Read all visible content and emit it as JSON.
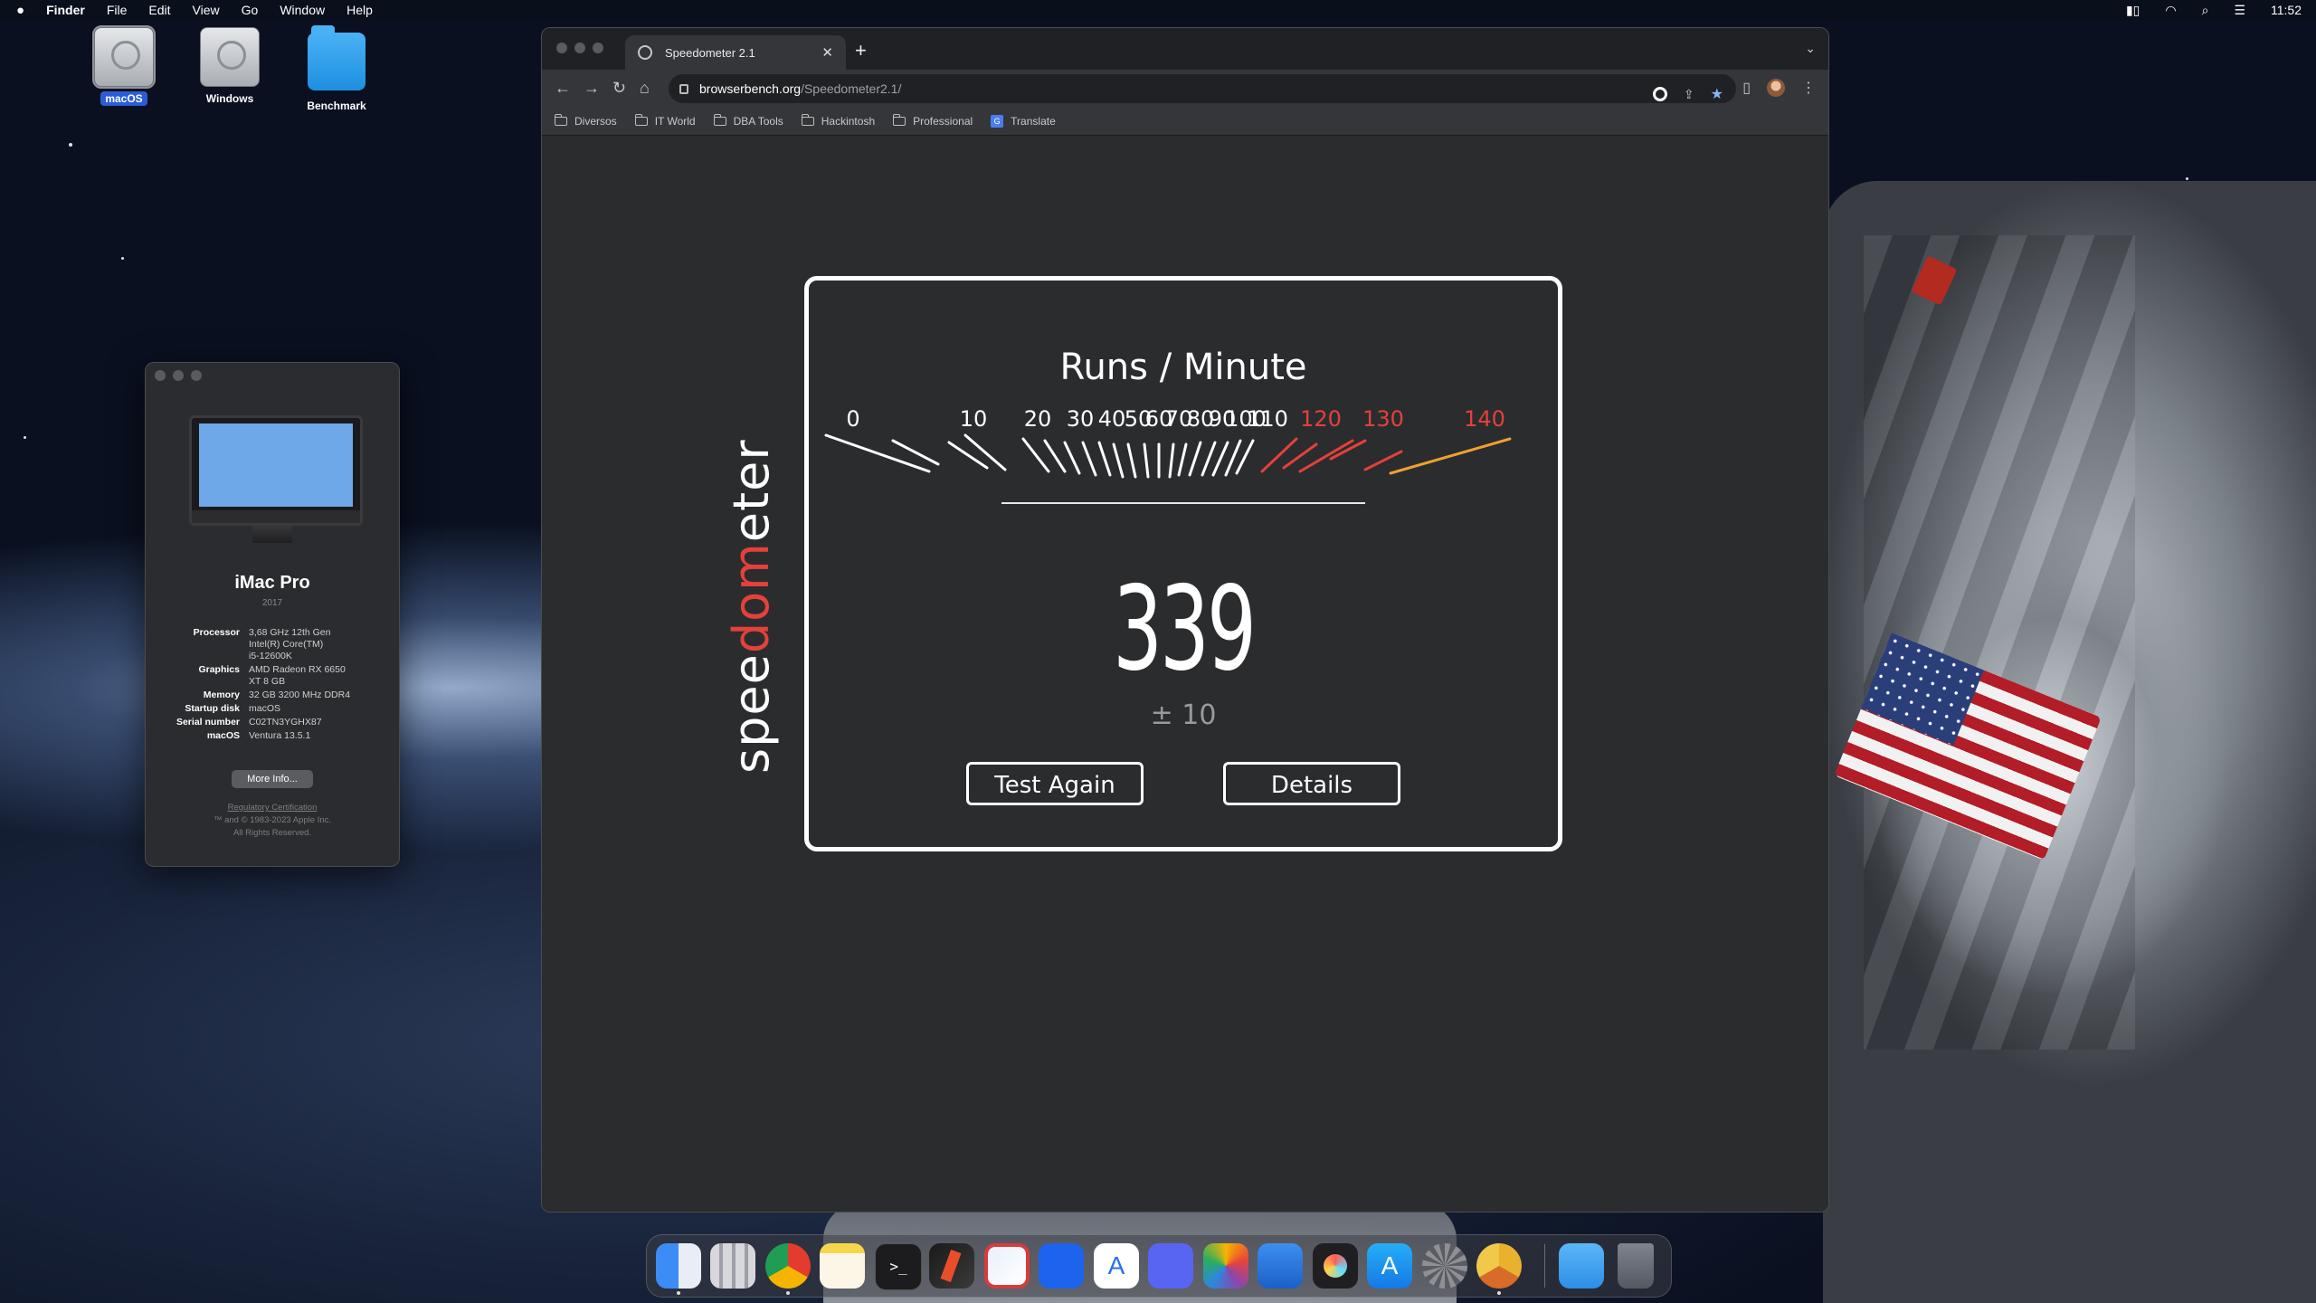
{
  "menubar": {
    "app": "Finder",
    "items": [
      "File",
      "Edit",
      "View",
      "Go",
      "Window",
      "Help"
    ],
    "clock": "11:52"
  },
  "desktop": {
    "icons": [
      {
        "label": "macOS",
        "kind": "disk-icon",
        "selected": true
      },
      {
        "label": "Windows",
        "kind": "disk-icon",
        "selected": false
      },
      {
        "label": "Benchmark",
        "kind": "folder-icon",
        "selected": false
      }
    ]
  },
  "about": {
    "model": "iMac Pro",
    "year": "2017",
    "specs": [
      {
        "key": "Processor",
        "value": "3,68 GHz 12th Gen\nIntel(R) Core(TM)\ni5-12600K"
      },
      {
        "key": "Graphics",
        "value": "AMD Radeon RX 6650\nXT 8 GB"
      },
      {
        "key": "Memory",
        "value": "32 GB 3200 MHz DDR4"
      },
      {
        "key": "Startup disk",
        "value": "macOS"
      },
      {
        "key": "Serial number",
        "value": "C02TN3YGHX87"
      },
      {
        "key": "macOS",
        "value": "Ventura 13.5.1"
      }
    ],
    "more_button": "More Info...",
    "regulatory": "Regulatory Certification",
    "copyright": "™ and © 1983-2023 Apple Inc.",
    "rights": "All Rights Reserved."
  },
  "browser": {
    "tab_title": "Speedometer 2.1",
    "url_host": "browserbench.org",
    "url_path": "/Speedometer2.1/",
    "bookmarks": [
      {
        "label": "Diversos",
        "icon": "folder-icon"
      },
      {
        "label": "IT World",
        "icon": "folder-icon"
      },
      {
        "label": "DBA Tools",
        "icon": "folder-icon"
      },
      {
        "label": "Hackintosh",
        "icon": "folder-icon"
      },
      {
        "label": "Professional",
        "icon": "folder-icon"
      },
      {
        "label": "Translate",
        "icon": "translate-icon"
      }
    ]
  },
  "speedometer": {
    "brand_pre": "spee",
    "brand_accent": "dom",
    "brand_post": "eter",
    "title": "Runs / Minute",
    "score": "339",
    "margin": "± 10",
    "test_again": "Test Again",
    "details": "Details",
    "ticks_white": [
      "0",
      "10",
      "20",
      "30",
      "40",
      "50",
      "60",
      "70",
      "80",
      "90",
      "100",
      "110"
    ],
    "ticks_red": [
      "120",
      "130",
      "140"
    ],
    "colors": {
      "accent": "#e4413a",
      "needle": "#f0a030"
    }
  },
  "dock": {
    "apps": [
      "finder-icon",
      "launchpad-icon",
      "chrome-icon",
      "notes-icon",
      "terminal-icon",
      "toolbox-icon",
      "remote-desktop-icon",
      "docker-icon",
      "textedit-icon",
      "discord-icon",
      "pixelmator-icon",
      "preview-icon",
      "davinci-resolve-icon",
      "app-store-icon",
      "system-settings-icon",
      "chrome-canary-icon",
      "downloads-folder-icon",
      "trash-icon"
    ]
  }
}
